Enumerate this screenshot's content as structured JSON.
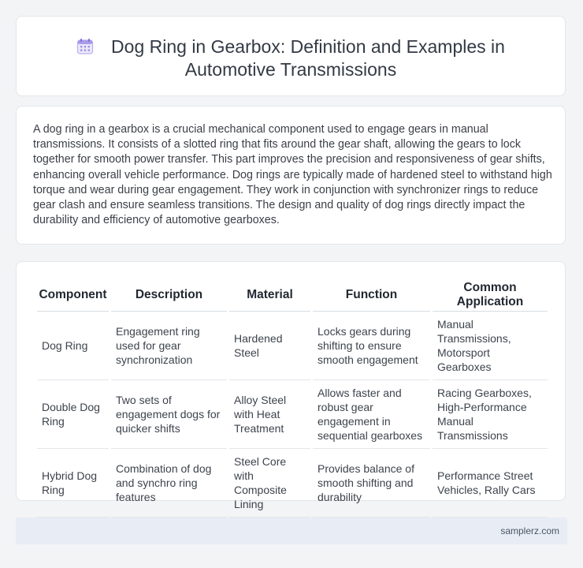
{
  "header": {
    "icon": "calendar-icon",
    "title_line1": "Dog Ring in Gearbox: Definition and Examples in",
    "title_line2": "Automotive Transmissions"
  },
  "description": "A dog ring in a gearbox is a crucial mechanical component used to engage gears in manual transmissions. It consists of a slotted ring that fits around the gear shaft, allowing the gears to lock together for smooth power transfer. This part improves the precision and responsiveness of gear shifts, enhancing overall vehicle performance. Dog rings are typically made of hardened steel to withstand high torque and wear during gear engagement. They work in conjunction with synchronizer rings to reduce gear clash and ensure seamless transitions. The design and quality of dog rings directly impact the durability and efficiency of automotive gearboxes.",
  "table": {
    "headers": [
      "Component",
      "Description",
      "Material",
      "Function",
      "Common Application"
    ],
    "rows": [
      [
        "Dog Ring",
        "Engagement ring used for gear synchronization",
        "Hardened Steel",
        "Locks gears during shifting to ensure smooth engagement",
        "Manual Transmissions, Motorsport Gearboxes"
      ],
      [
        "Double Dog Ring",
        "Two sets of engagement dogs for quicker shifts",
        "Alloy Steel with Heat Treatment",
        "Allows faster and robust gear engagement in sequential gearboxes",
        "Racing Gearboxes, High-Performance Manual Transmissions"
      ],
      [
        "Hybrid Dog Ring",
        "Combination of dog and synchro ring features",
        "Steel Core with Composite Lining",
        "Provides balance of smooth shifting and durability",
        "Performance Street Vehicles, Rally Cars"
      ]
    ]
  },
  "footer": {
    "site": "samplerz.com"
  },
  "colors": {
    "background": "#f3f4f6",
    "card": "#ffffff",
    "footer": "#e8ecf5",
    "icon_accent": "#9b8fe0"
  }
}
